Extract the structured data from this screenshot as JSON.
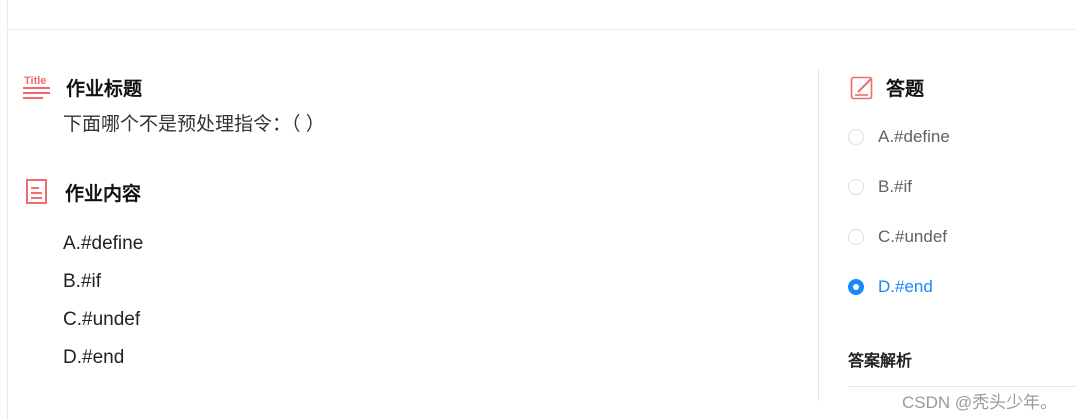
{
  "colors": {
    "accent": "#1989fa",
    "icon": "#f06b6b",
    "divider": "#e3e3e3"
  },
  "title_section": {
    "icon": "title-icon",
    "icon_text": "Title",
    "heading": "作业标题",
    "question": "下面哪个不是预处理指令：（ ）"
  },
  "content_section": {
    "icon": "document-icon",
    "heading": "作业内容",
    "options": [
      "A.#define",
      "B.#if",
      "C.#undef",
      "D.#end"
    ]
  },
  "answer_section": {
    "icon": "edit-icon",
    "heading": "答题",
    "choices": [
      {
        "label": "A.#define",
        "selected": false
      },
      {
        "label": "B.#if",
        "selected": false
      },
      {
        "label": "C.#undef",
        "selected": false
      },
      {
        "label": "D.#end",
        "selected": true
      }
    ],
    "analysis_heading": "答案解析"
  },
  "watermark": "CSDN @秃头少年。"
}
